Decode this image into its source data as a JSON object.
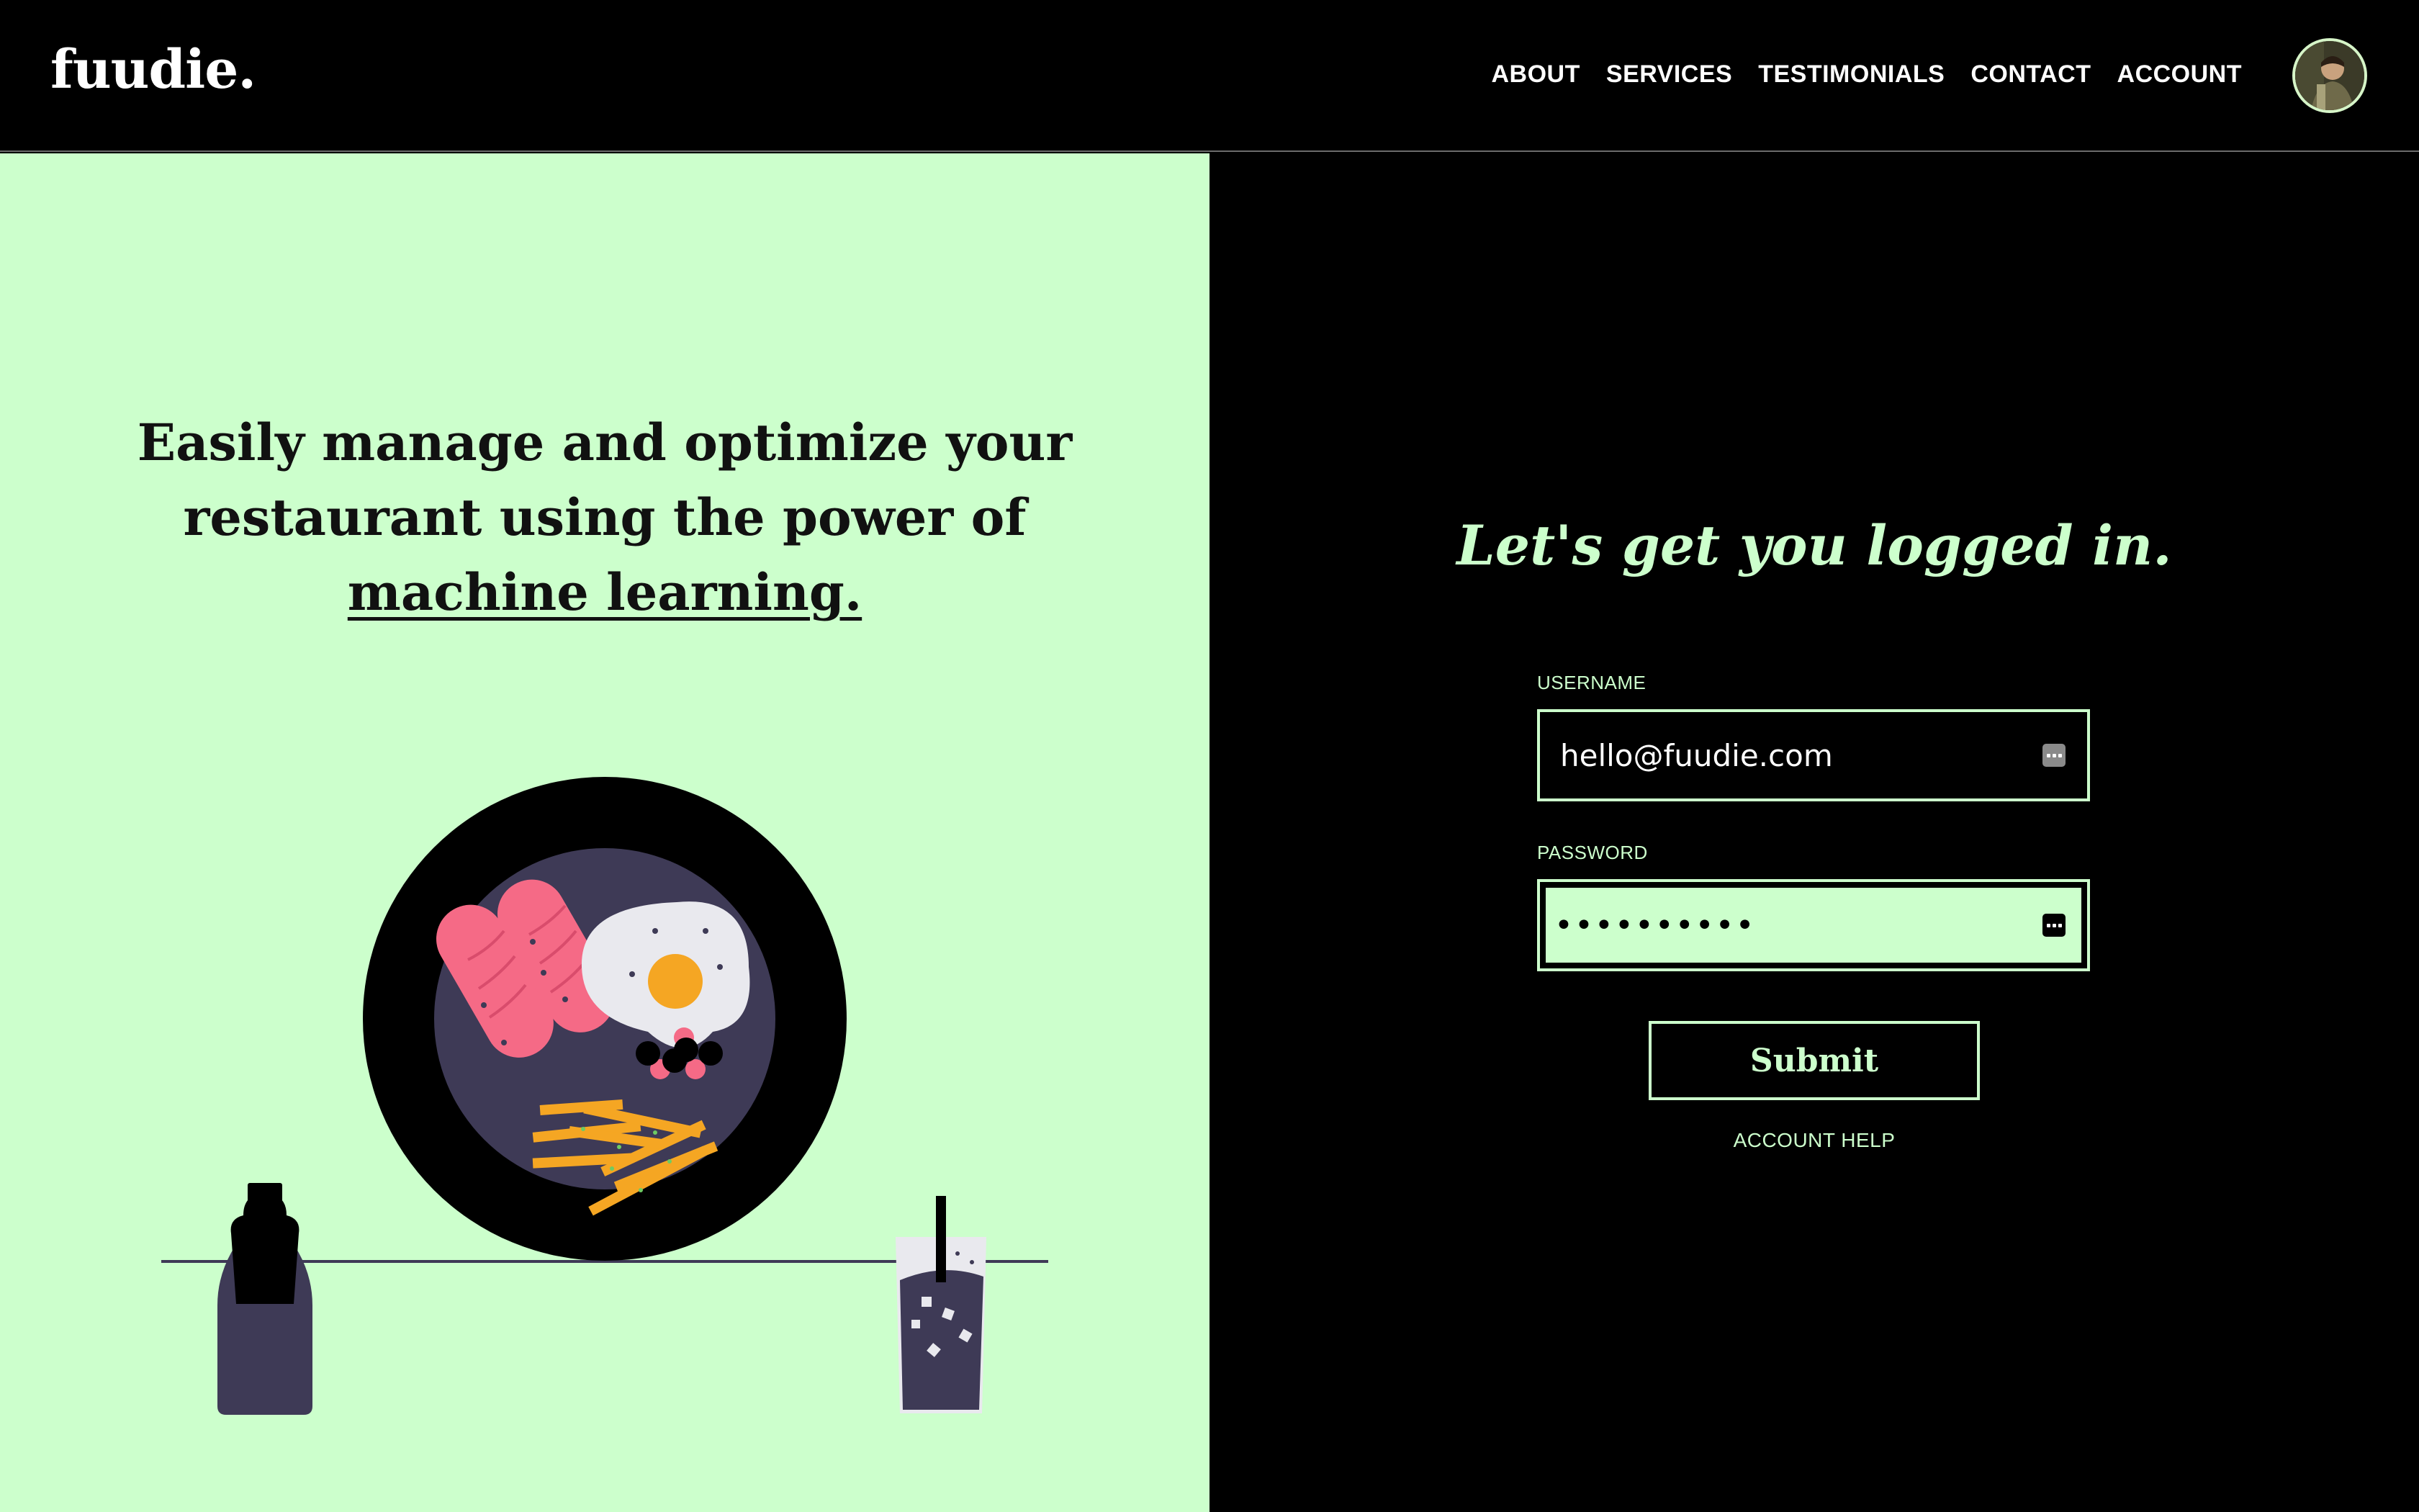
{
  "header": {
    "logo": "fuudie.",
    "nav": [
      "ABOUT",
      "SERVICES",
      "TESTIMONIALS",
      "CONTACT",
      "ACCOUNT"
    ]
  },
  "hero": {
    "headline_prefix": "Easily manage and optimize your restaurant using the power of ",
    "headline_link": "machine learning."
  },
  "login": {
    "title": "Let's get you logged in.",
    "username_label": "USERNAME",
    "username_value": "hello@fuudie.com",
    "password_label": "PASSWORD",
    "password_value": "••••••••••",
    "submit_label": "Submit",
    "help_label": "ACCOUNT HELP"
  },
  "colors": {
    "accent": "#ccffcc",
    "background": "#000000",
    "plate_inner": "#3e3a56",
    "sausage": "#f56a86",
    "egg_yolk": "#f5a623",
    "fries": "#f5a623"
  }
}
